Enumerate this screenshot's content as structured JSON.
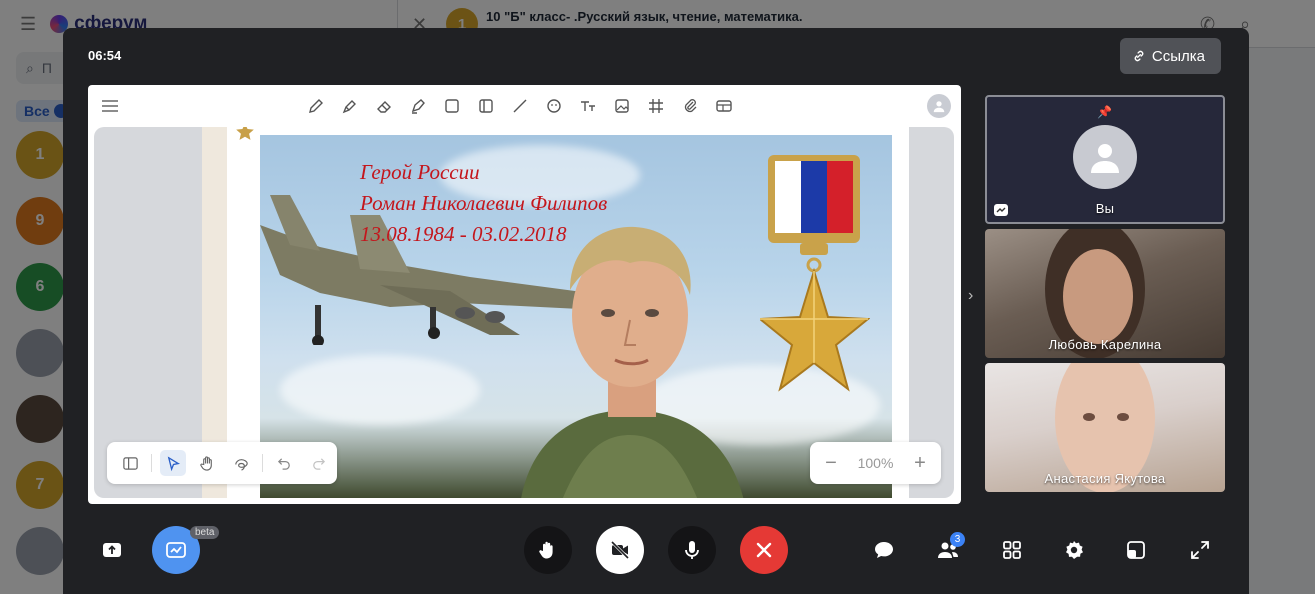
{
  "background_app": {
    "logo_text": "сферум",
    "search_placeholder": "П",
    "tab_all_label": "Все",
    "chat_avatars": [
      "1",
      "9",
      "6",
      "",
      "",
      "7",
      ""
    ],
    "chat_title": "10 \"Б\" класс- .Русский язык, чтение, математика.",
    "header_avatar_letter": "1"
  },
  "call": {
    "timer": "06:54",
    "link_button_label": "Ссылка",
    "whiteboard": {
      "slide_caption_line1": "Герой России",
      "slide_caption_line2": "Роман Николаевич Филипов",
      "slide_caption_line3": "13.08.1984 -  03.02.2018",
      "zoom_value": "100%",
      "zoom_out_label": "−",
      "zoom_in_label": "+"
    },
    "participants": [
      {
        "name": "Вы",
        "is_self": true,
        "pinned": true
      },
      {
        "name": "Любовь Карелина",
        "is_self": false
      },
      {
        "name": "Анастасия Якутова",
        "is_self": false
      }
    ],
    "controls": {
      "beta_label": "beta",
      "participants_count": "3"
    }
  },
  "colors": {
    "call_bg": "#202124",
    "hangup_red": "#e53935",
    "board_btn_blue": "#4f93f0",
    "caption_red": "#c4161c"
  }
}
